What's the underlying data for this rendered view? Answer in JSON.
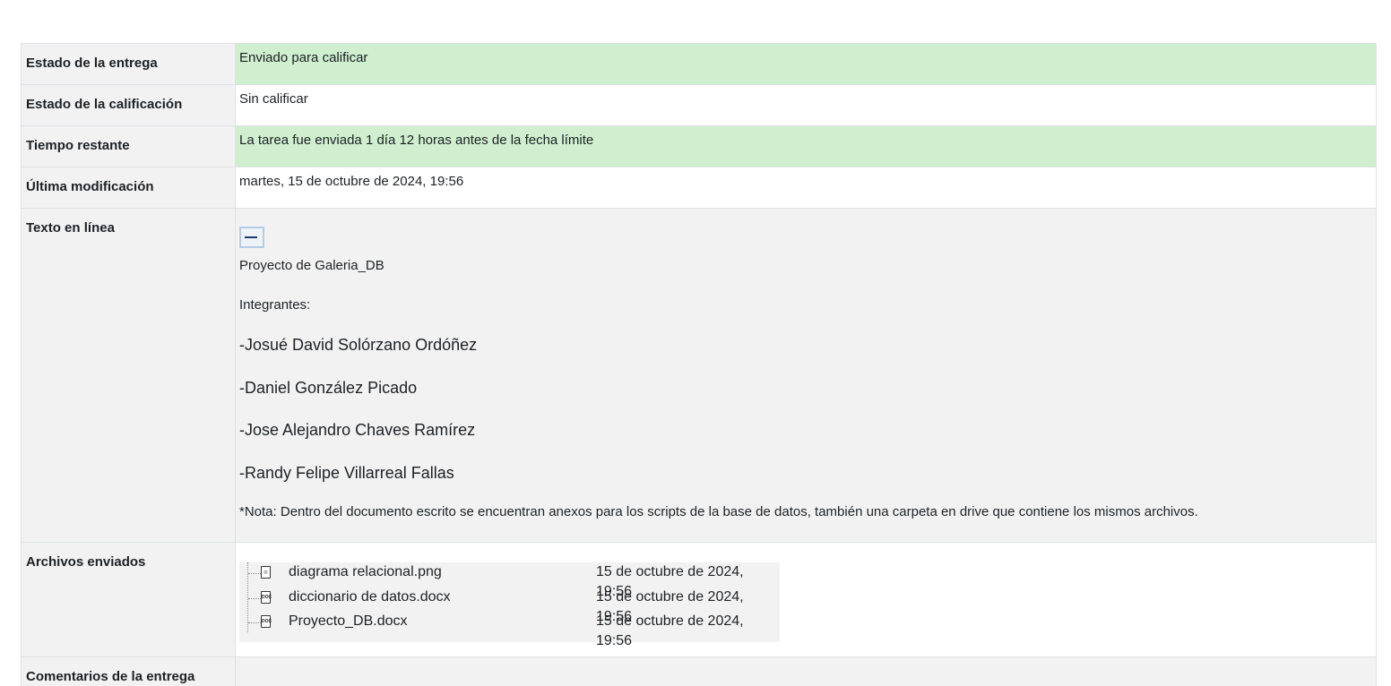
{
  "rows": {
    "submission_status": {
      "label": "Estado de la entrega",
      "value": "Enviado para calificar"
    },
    "grading_status": {
      "label": "Estado de la calificación",
      "value": "Sin calificar"
    },
    "time_remaining": {
      "label": "Tiempo restante",
      "value": "La tarea fue enviada 1 día 12 horas antes de la fecha límite"
    },
    "last_modified": {
      "label": "Última modificación",
      "value": "martes, 15 de octubre de 2024, 19:56"
    },
    "online_text": {
      "label": "Texto en línea",
      "collapse_icon": "minus-icon",
      "title": "Proyecto de Galeria_DB",
      "members_heading": "Integrantes:",
      "members": [
        "-Josué David Solórzano Ordóñez",
        "-Daniel González Picado",
        "-Jose Alejandro Chaves Ramírez",
        "-Randy Felipe Villarreal Fallas"
      ],
      "note": "*Nota: Dentro del documento escrito se encuentran anexos para los scripts de la base de datos, también una carpeta en drive que contiene los mismos archivos."
    },
    "files": {
      "label": "Archivos enviados",
      "items": [
        {
          "name": "diagrama relacional.png",
          "date": "15 de octubre de 2024, 19:56",
          "icon": "image-file-icon"
        },
        {
          "name": "diccionario de datos.docx",
          "date": "15 de octubre de 2024, 19:56",
          "icon": "document-file-icon"
        },
        {
          "name": "Proyecto_DB.docx",
          "date": "15 de octubre de 2024, 19:56",
          "icon": "document-file-icon"
        }
      ]
    },
    "comments": {
      "label": "Comentarios de la entrega"
    }
  },
  "colors": {
    "success_bg": "#cfefcf",
    "label_bg": "#f2f2f2",
    "border": "#dee2e6"
  }
}
